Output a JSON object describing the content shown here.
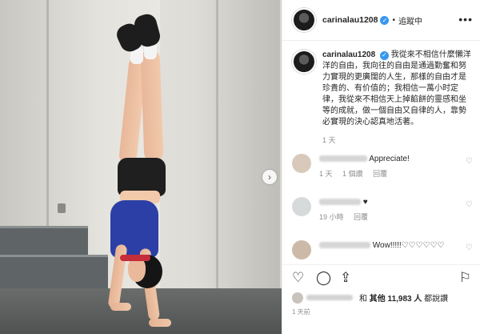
{
  "header": {
    "username": "carinalau1208",
    "verified_icon": "verified-badge-icon",
    "separator": "•",
    "following_label": "追蹤中",
    "more_icon": "more-options-icon"
  },
  "caption": {
    "username": "carinalau1208",
    "text": "我從來不相信什麼懶洋洋的自由，我向往的自由是通過勤奮和努力實現的更廣闊的人生，那樣的自由才是珍貴的、有价值的；我相信一萬小时定律，我從來不相信天上掉餡餅的靈感和坐等的成就，做一個自由又自律的人，靠勢必實現的決心認真地活著。",
    "time": "1 天"
  },
  "comments": [
    {
      "text": "Appreciate!",
      "time": "1 天",
      "likes": "1 個讚",
      "reply": "回覆"
    },
    {
      "text": "♥",
      "time": "19 小時",
      "reply": "回覆"
    },
    {
      "text": "Wow!!!!!♡♡♡♡♡♡"
    }
  ],
  "actions": {
    "like_icon": "heart-icon",
    "comment_icon": "comment-icon",
    "share_icon": "share-icon",
    "save_icon": "bookmark-icon"
  },
  "likes_summary": {
    "prefix": "和",
    "others": "其他 11,983 人",
    "suffix": "都說讚"
  },
  "post_date": "1 天前",
  "colors": {
    "verified": "#3897f0",
    "muted": "#8e8e8e",
    "text": "#262626"
  }
}
